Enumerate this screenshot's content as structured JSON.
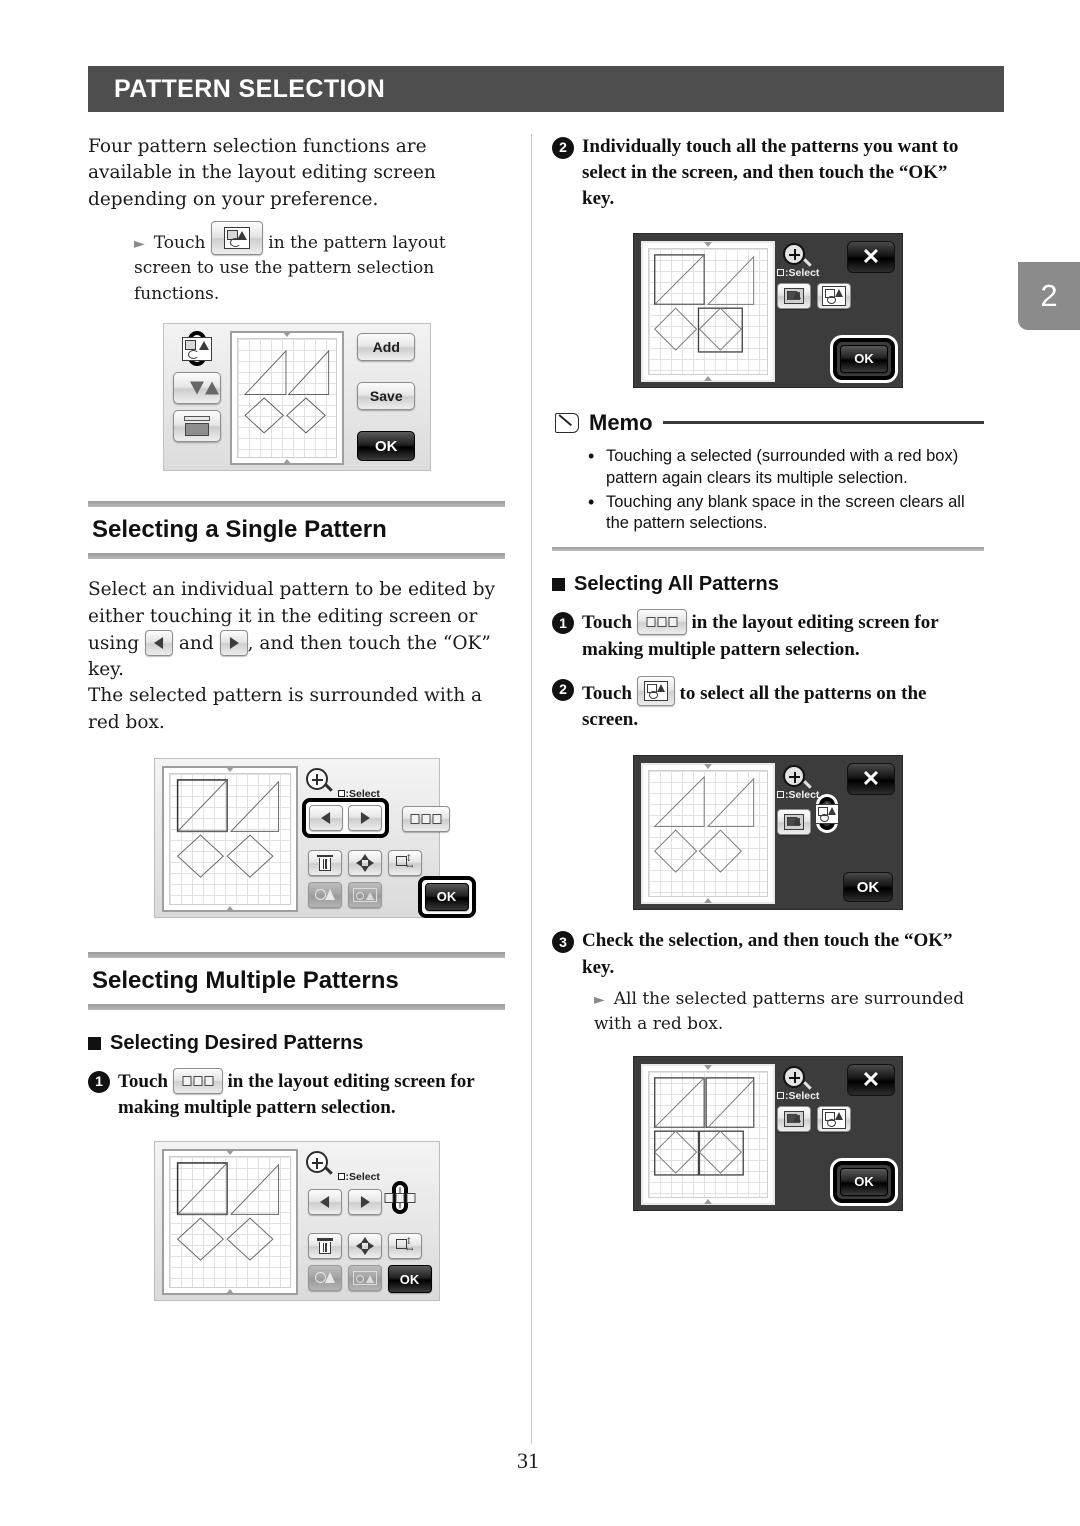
{
  "chapter_tab": "2",
  "page_number": "31",
  "header": {
    "title": "PATTERN SELECTION"
  },
  "intro": {
    "paragraph": "Four pattern selection functions are available in the layout editing screen depending on your preference.",
    "bullet_pre": "Touch",
    "bullet_post": "in the pattern layout screen to use the pattern selection functions."
  },
  "layout_screen": {
    "add_label": "Add",
    "save_label": "Save",
    "ok_label": "OK"
  },
  "single": {
    "heading": "Selecting a Single Pattern",
    "text_1": "Select an individual pattern to be edited by either touching it in the editing screen or using",
    "text_2": "and",
    "text_3": ", and then touch the “OK” key.",
    "text_4": "The selected pattern is surrounded with a red box."
  },
  "edit_screen": {
    "select_label": ":Select",
    "ok_label": "OK"
  },
  "multiple": {
    "heading": "Selecting Multiple Patterns",
    "desired_heading": "Selecting Desired Patterns",
    "step1_num": "1",
    "step1_pre": "Touch",
    "step1_post": "in the layout editing screen for making multiple pattern selection.",
    "step2_num": "2",
    "step2_text": "Individually touch all the patterns you want to select in the screen, and then touch the “OK” key."
  },
  "memo": {
    "title": "Memo",
    "items": [
      "Touching a selected (surrounded with a red box) pattern again clears its multiple selection.",
      "Touching any blank space in the screen clears all the pattern selections."
    ]
  },
  "all_patterns": {
    "heading": "Selecting All Patterns",
    "step1_num": "1",
    "step1_pre": "Touch",
    "step1_post": "in the layout editing screen for making multiple pattern selection.",
    "step2_num": "2",
    "step2_pre": "Touch",
    "step2_post": "to select all the patterns on the screen.",
    "step3_num": "3",
    "step3_text": "Check the selection, and then touch the “OK” key.",
    "step3_bullet": "All the selected patterns are surrounded with a red box."
  },
  "dark_screen": {
    "select_label": ":Select",
    "ok_label": "OK",
    "close_label": "✕"
  },
  "icons": {
    "pattern_select": "pattern-select-icon",
    "multi_select": "multi-select-icon",
    "select_all": "select-all-icon",
    "arrow_left": "arrow-left-icon",
    "arrow_right": "arrow-right-icon",
    "zoom": "zoom-in-icon",
    "trash": "trash-icon",
    "move": "move-icon",
    "resize": "resize-icon",
    "memo": "memo-book-icon"
  },
  "colors": {
    "header_bg": "#4e4e4e",
    "tab_bg": "#8b8b8b",
    "lcd_dark": "#3c3c3c",
    "rule": "#9a9a9a"
  }
}
